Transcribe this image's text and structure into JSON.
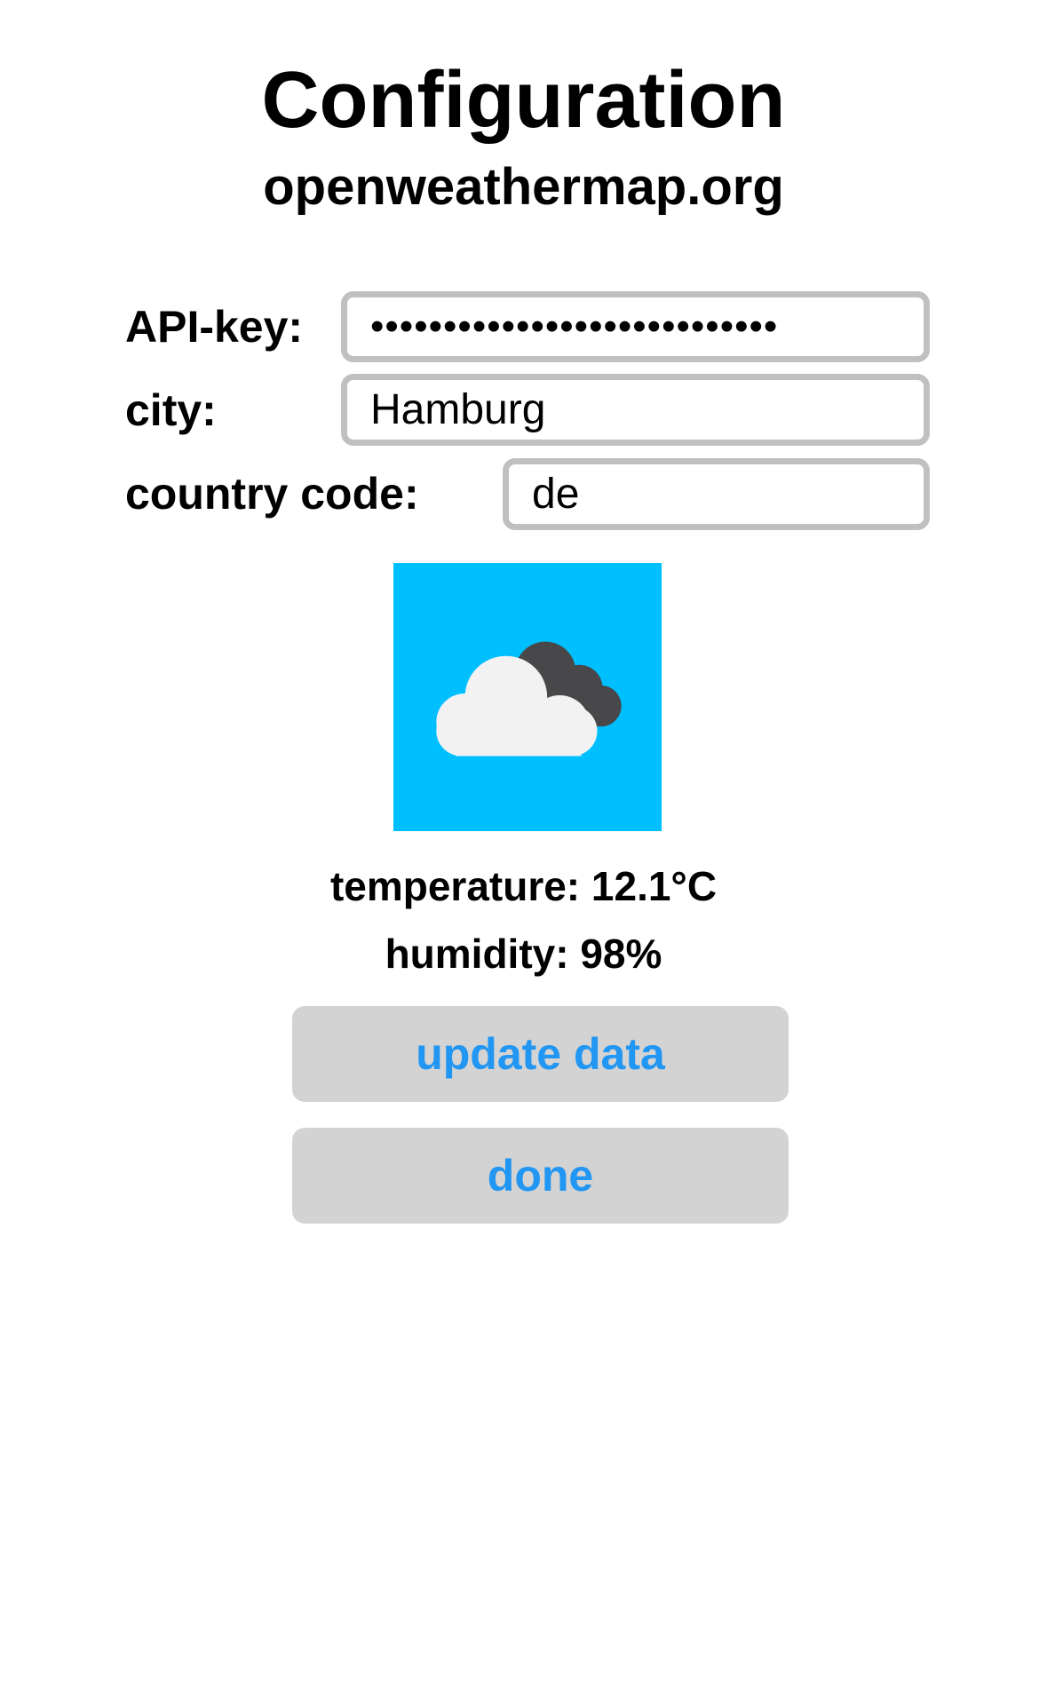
{
  "header": {
    "title": "Configuration",
    "subtitle": "openweathermap.org"
  },
  "form": {
    "api_key": {
      "label": "API-key:",
      "value": "••••••••••••••••••••••••••••"
    },
    "city": {
      "label": "city:",
      "value": "Hamburg"
    },
    "country_code": {
      "label": "country code:",
      "value": "de"
    }
  },
  "weather": {
    "icon": "cloud-icon",
    "icon_bg_color": "#00bfff",
    "temperature": "temperature: 12.1°C",
    "humidity": "humidity: 98%"
  },
  "buttons": {
    "update": "update data",
    "done": "done",
    "text_color": "#2196f3"
  }
}
